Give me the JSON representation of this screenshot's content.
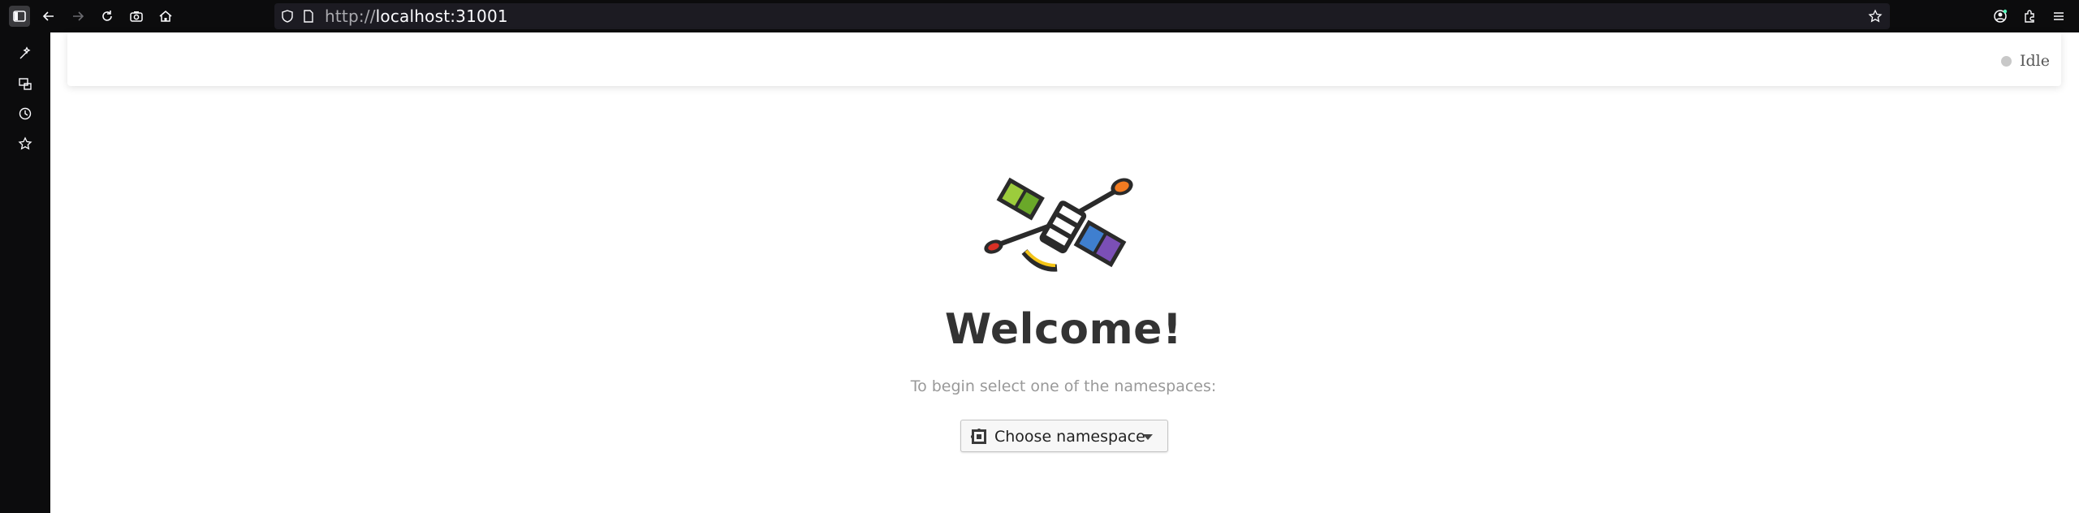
{
  "browser": {
    "url_scheme": "http://",
    "url_host": "localhost:31001"
  },
  "status": {
    "label": "Idle"
  },
  "main": {
    "title": "Welcome!",
    "subtitle": "To begin select one of the namespaces:",
    "namespace_button": "Choose namespace"
  },
  "colors": {
    "title": "#333333",
    "subtitle": "#999999",
    "status_dot": "#c8c8c8"
  },
  "icons": {
    "topbar": [
      "sidebar-icon",
      "back-icon",
      "forward-icon",
      "reload-icon",
      "screenshot-icon",
      "home-icon",
      "shield-icon",
      "page-icon",
      "star-icon",
      "account-icon",
      "extensions-icon",
      "menu-icon"
    ],
    "leftbar": [
      "ai-sparkle-icon",
      "synced-tabs-icon",
      "history-icon",
      "bookmarks-icon"
    ],
    "logo": "satellite-logo-icon",
    "namespace": "namespace-icon"
  }
}
